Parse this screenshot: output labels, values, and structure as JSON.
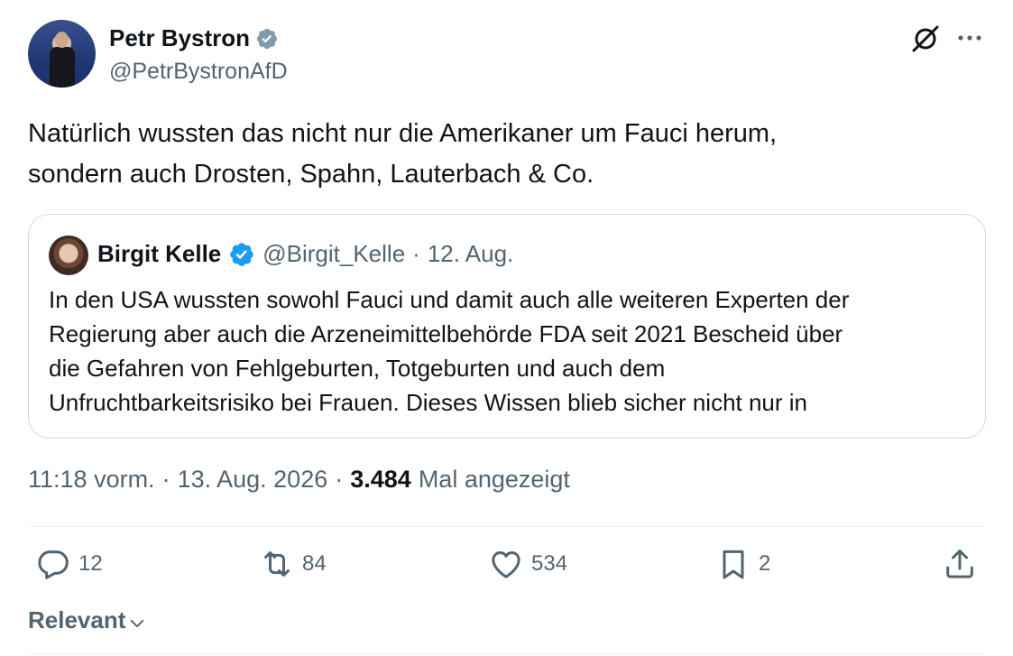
{
  "colors": {
    "text": "#0f1419",
    "secondary": "#536471",
    "verified_blue": "#1d9bf0",
    "verified_gray": "#829aab",
    "border": "#cfd9de"
  },
  "author": {
    "name": "Petr Bystron",
    "handle": "@PetrBystronAfD",
    "verified_badge": "gray-verified-icon"
  },
  "tweet": {
    "text": "Natürlich wussten das nicht nur die Amerikaner um Fauci herum,\nsondern auch Drosten, Spahn, Lauterbach & Co."
  },
  "quote": {
    "name": "Birgit Kelle",
    "handle": "@Birgit_Kelle",
    "separator": "·",
    "date": "12. Aug.",
    "verified_badge": "blue-verified-icon",
    "text": "In den USA wussten sowohl Fauci und damit auch alle weiteren Experten der\nRegierung aber auch die Arzeneimittelbehörde FDA seit 2021 Bescheid über\ndie Gefahren von Fehlgeburten, Totgeburten und auch dem\nUnfruchtbarkeitsrisiko bei Frauen. Dieses Wissen blieb sicher nicht nur in"
  },
  "meta": {
    "time": "11:18 vorm.",
    "sep1": "·",
    "date": "13. Aug. 2026",
    "sep2": "·",
    "views_count": "3.484",
    "views_label": "Mal angezeigt"
  },
  "actions": {
    "replies": "12",
    "reposts": "84",
    "likes": "534",
    "bookmarks": "2"
  },
  "sort": {
    "label": "Relevant"
  },
  "icons": [
    "grok-icon",
    "more-icon",
    "reply-icon",
    "repost-icon",
    "like-icon",
    "bookmark-icon",
    "share-icon",
    "chevron-down-icon"
  ]
}
